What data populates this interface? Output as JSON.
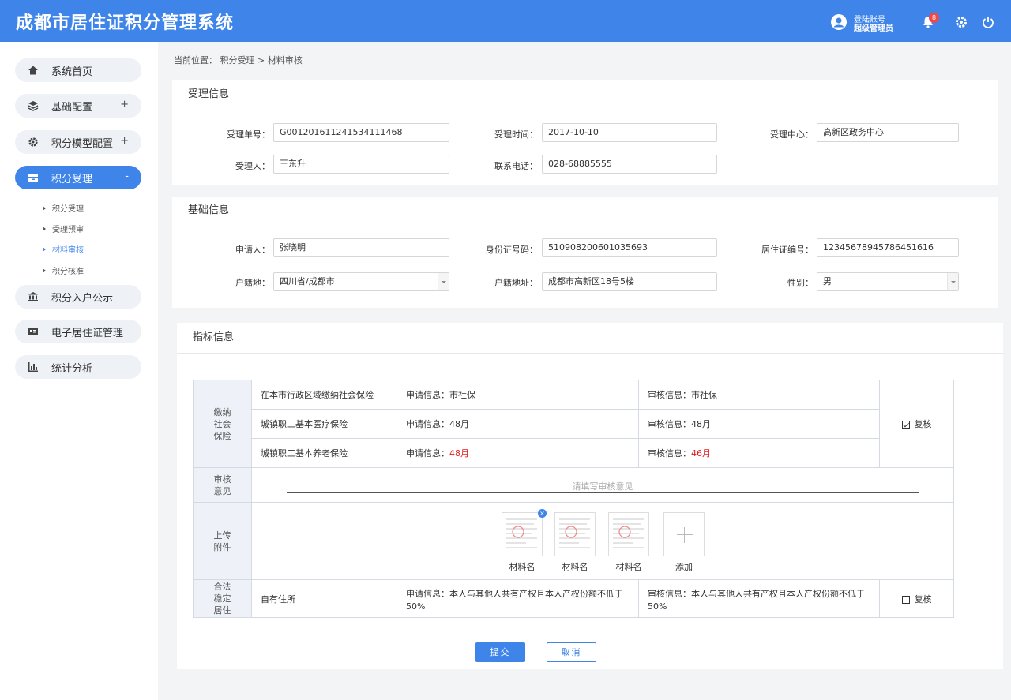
{
  "header": {
    "app_title": "成都市居住证积分管理系统",
    "account_line1": "登陆账号",
    "account_line2": "超级管理员",
    "notification_count": "8"
  },
  "sidebar": {
    "items": [
      {
        "label": "系统首页",
        "icon": "home-icon",
        "toggle": ""
      },
      {
        "label": "基础配置",
        "icon": "layers-icon",
        "toggle": "+"
      },
      {
        "label": "积分模型配置",
        "icon": "gear-icon",
        "toggle": "+"
      },
      {
        "label": "积分受理",
        "icon": "inbox-icon",
        "toggle": "-"
      },
      {
        "label": "积分入户公示",
        "icon": "bank-icon",
        "toggle": ""
      },
      {
        "label": "电子居住证管理",
        "icon": "id-card-icon",
        "toggle": ""
      },
      {
        "label": "统计分析",
        "icon": "bar-chart-icon",
        "toggle": ""
      }
    ],
    "subitems": [
      "积分受理",
      "受理预审",
      "材料审核",
      "积分核准"
    ]
  },
  "breadcrumb": "当前位置：  积分受理 > 材料审核",
  "acceptance": {
    "title": "受理信息",
    "fields": {
      "number_label": "受理单号：",
      "number": "G0012016112415341114​68",
      "time_label": "受理时间：",
      "time": "2017-10-10",
      "center_label": "受理中心：",
      "center": "高新区政务中心",
      "person_label": "受理人：",
      "person": "王东升",
      "phone_label": "联系电话：",
      "phone": "028-68885555"
    }
  },
  "basic": {
    "title": "基础信息",
    "fields": {
      "applicant_label": "申请人：",
      "applicant": "张晓明",
      "idno_label": "身份证号码：",
      "idno": "510908200601035693",
      "permit_label": "居住证编号：",
      "permit": "12345678945786451616",
      "hukou_label": "户籍地：",
      "hukou": "四川省/成都市",
      "address_label": "户籍地址：",
      "address": "成都市高新区18号5楼",
      "gender_label": "性别：",
      "gender": "男"
    }
  },
  "indicator": {
    "title": "指标信息",
    "social_cat": [
      "缴纳",
      "社会",
      "保险"
    ],
    "rows": [
      {
        "item": "在本市行政区域缴纳社会保险",
        "apply_label": "申请信息：",
        "apply": "市社保",
        "review_label": "审核信息：",
        "review": "市社保",
        "mismatch": false
      },
      {
        "item": "城镇职工基本医疗保险",
        "apply_label": "申请信息：",
        "apply": "48月",
        "review_label": "审核信息：",
        "review": "48月",
        "mismatch": false
      },
      {
        "item": "城镇职工基本养老保险",
        "apply_label": "申请信息：",
        "apply": "48月",
        "review_label": "审核信息：",
        "review": "46月",
        "mismatch": true
      }
    ],
    "recheck_label": "复核",
    "opinion_cat": [
      "审核",
      "意见"
    ],
    "opinion_placeholder": "请填写审核意见",
    "upload_cat": [
      "上传",
      "附件"
    ],
    "attachments": [
      "材料名",
      "材料名",
      "材料名"
    ],
    "add_label": "添加",
    "residence_cat": [
      "合法",
      "稳定",
      "居住"
    ],
    "residence_item": "自有住所",
    "residence_apply": "申请信息：本人与其他人共有产权且本人产权份额不低于50%",
    "residence_review": "审核信息：本人与其他人共有产权且本人产权份额不低于50%",
    "recheck_label2": "复核"
  },
  "actions": {
    "submit": "提交",
    "cancel": "取消"
  },
  "colors": {
    "primary": "#3f85e9",
    "mismatch": "#e02020"
  }
}
